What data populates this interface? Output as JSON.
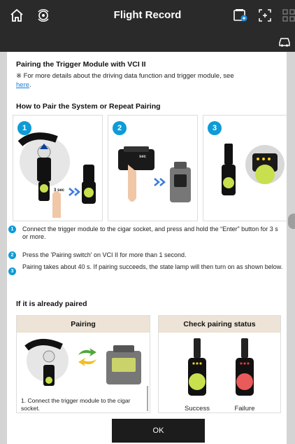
{
  "header": {
    "title": "Flight Record"
  },
  "intro": {
    "heading": "Pairing the Trigger Module with VCI II",
    "note": "※ For more details about the driving data function and trigger module, see",
    "link": "here",
    "link_suffix": "."
  },
  "howto": {
    "heading": "How to Pair the System or Repeat Pairing",
    "steps": [
      {
        "num": "1",
        "sec_label": "3 sec",
        "text": "Connect the trigger module to the cigar socket, and press and hold the “Enter” button for 3 s or more."
      },
      {
        "num": "2",
        "sec_label": "sec",
        "text": "Press the 'Pairing switch' on VCI II for more than 1 second."
      },
      {
        "num": "3",
        "text": "Pairing takes about 40 s. If pairing succeeds, the state lamp will then turn on as shown below."
      }
    ]
  },
  "paired": {
    "heading": "If it is already paired",
    "pairing": {
      "title": "Pairing",
      "caption": "1. Connect the trigger module to the cigar socket."
    },
    "check": {
      "title": "Check pairing status",
      "success": "Success",
      "failure": "Failure"
    }
  },
  "footer": {
    "ok_label": "OK"
  },
  "colors": {
    "bar": "#2a2a2a",
    "accent": "#0e9bd6",
    "tab_head": "#ede3d6",
    "link": "#1e7bd7"
  },
  "icons": [
    "home-icon",
    "vci-connect-icon",
    "vci-device-icon",
    "capture-icon",
    "grid-icon",
    "car-icon",
    "arrow-double-icon",
    "sync-icon"
  ]
}
